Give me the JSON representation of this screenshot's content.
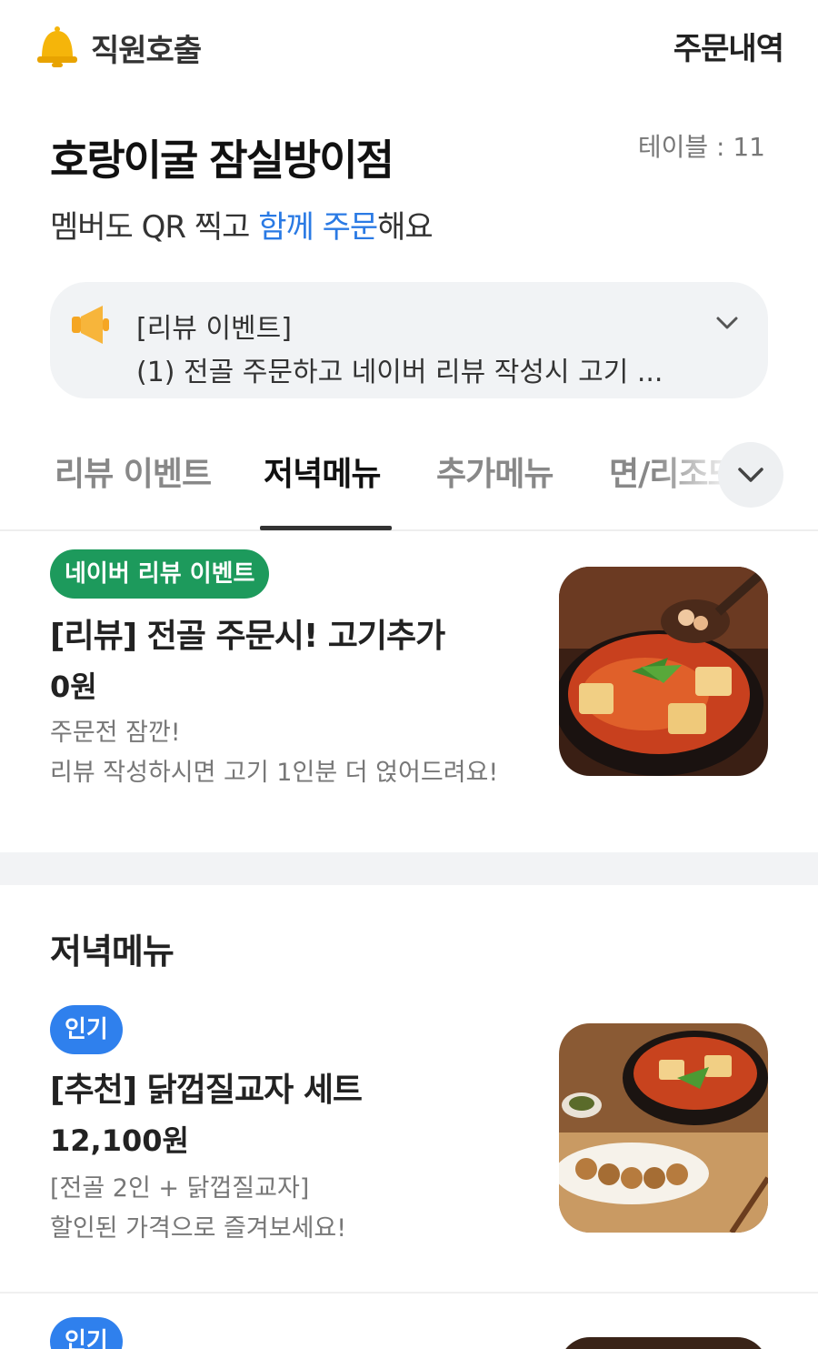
{
  "header": {
    "call_staff_label": "직원호출",
    "order_history_label": "주문내역"
  },
  "store": {
    "name": "호랑이굴 잠실방이점",
    "table_label": "테이블 : 11",
    "subtitle_prefix": "멤버도 QR 찍고 ",
    "subtitle_highlight": "함께 주문",
    "subtitle_suffix": "해요"
  },
  "notice": {
    "title": "[리뷰 이벤트]",
    "body": "(1) 전골 주문하고 네이버 리뷰 작성시 고기 ..."
  },
  "tabs": [
    {
      "label": "리뷰 이벤트",
      "active": false
    },
    {
      "label": "저녁메뉴",
      "active": true
    },
    {
      "label": "추가메뉴",
      "active": false
    },
    {
      "label": "면/리조또",
      "active": false
    }
  ],
  "items": [
    {
      "badge": "네이버 리뷰 이벤트",
      "title": "[리뷰] 전골 주문시! 고기추가",
      "price": "0원",
      "desc_line1": "주문전 잠깐!",
      "desc_line2": "리뷰 작성하시면 고기 1인분 더 얹어드려요!"
    },
    {
      "badge": "인기",
      "title": "[추천] 닭껍질교자 세트",
      "price": "12,100원",
      "desc_line1": "[전골 2인 + 닭껍질교자]",
      "desc_line2": "할인된 가격으로 즐겨보세요!"
    },
    {
      "badge": "인기"
    }
  ],
  "section": {
    "title": "저녁메뉴"
  },
  "colors": {
    "accent_blue": "#2a7ae4",
    "badge_green": "#1d9a5c",
    "badge_blue": "#2f80ed",
    "bell_yellow": "#f5b50a"
  },
  "icons": [
    "bell-icon",
    "megaphone-icon",
    "chevron-down-icon"
  ]
}
